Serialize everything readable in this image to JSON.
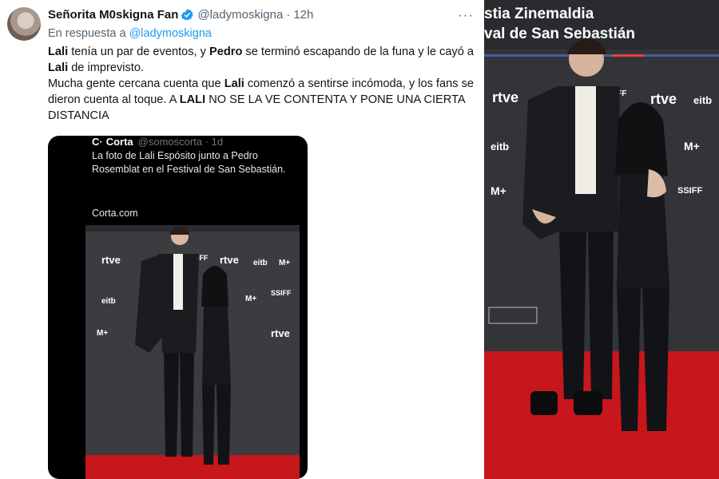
{
  "tweet": {
    "author_name": "Señorita M0skigna Fan",
    "author_handle": "@ladymoskigna",
    "separator": "·",
    "time": "12h",
    "more": "···",
    "reply_prefix": "En respuesta a",
    "reply_to": "@ladymoskigna",
    "body_parts": {
      "p1a": "Lali",
      "p1b": " tenía un par de eventos, y ",
      "p1c": "Pedro",
      "p1d": " se terminó escapando de la funa y le cayó a ",
      "p1e": "Lali",
      "p1f": " de imprevisto.",
      "p2a": "Mucha gente cercana cuenta que ",
      "p2b": "Lali",
      "p2c": " comenzó a sentirse incómoda, y los fans se dieron cuenta al toque. A ",
      "p2d": "LALI",
      "p2e": " NO SE LA VE CONTENTA Y PONE UNA CIERTA DISTANCIA"
    }
  },
  "quoted": {
    "logo": "C·",
    "name": "Corta",
    "handle": "@somoscorta · 1d",
    "text": "La foto de Lali Espósito junto a Pedro Rosemblat en el Festival de San Sebastián.",
    "site": "Corta.com"
  },
  "photo_right": {
    "banner_line1": "stia Zinemaldia",
    "banner_line2": "val de San Sebastián",
    "logos": [
      "rtve",
      "SSIFF",
      "rtve",
      "eitb",
      "eitb",
      "M+",
      "SSIFF",
      "M+"
    ]
  },
  "embed_photo": {
    "logos": [
      "rtve",
      "SSIFF",
      "rtve",
      "eitb",
      "M+",
      "eitb",
      "M+",
      "SSIFF",
      "M+",
      "rtve"
    ]
  },
  "colors": {
    "verified": "#1d9bf0",
    "mention": "#1d9bf0",
    "carpet": "#c8161d",
    "rtve": "#e5463a"
  }
}
